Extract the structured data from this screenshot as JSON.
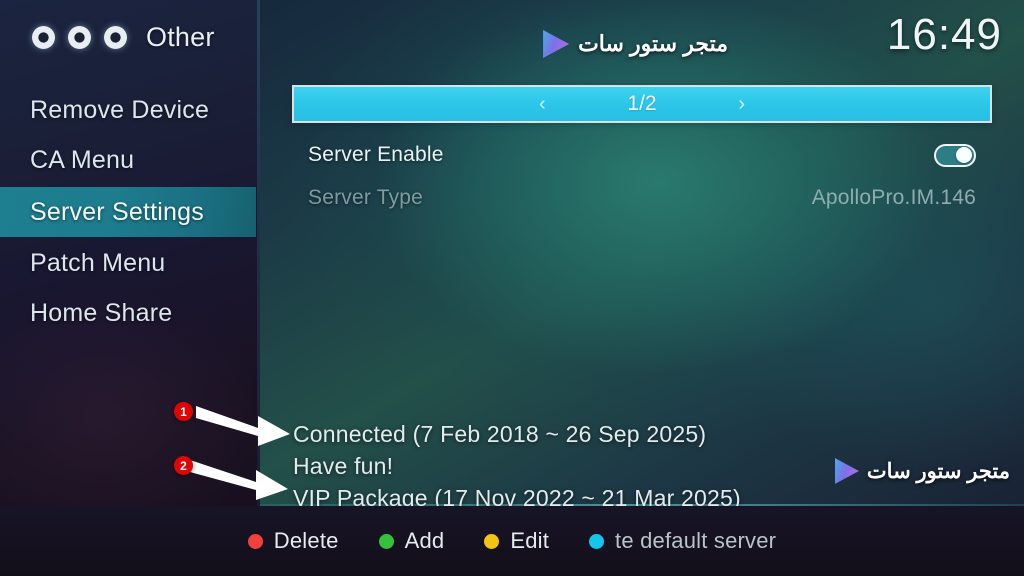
{
  "sidebar": {
    "brand": {
      "label": "Other",
      "dots_icon": "three-dots-icon"
    },
    "items": [
      {
        "label": "Remove Device",
        "active": false
      },
      {
        "label": "CA Menu",
        "active": false
      },
      {
        "label": "Server Settings",
        "active": true
      },
      {
        "label": "Patch Menu",
        "active": false
      },
      {
        "label": "Home Share",
        "active": false
      }
    ]
  },
  "header": {
    "brand_text": "متجر ستور سات",
    "play_icon": "play-triangle-icon",
    "clock": "16:49"
  },
  "pager": {
    "label": "1/2",
    "prev_icon": "‹",
    "next_icon": "›"
  },
  "settings": {
    "rows": [
      {
        "label": "Server Enable",
        "value": "",
        "control": "toggle",
        "toggle_on": true
      },
      {
        "label": "Server Type",
        "value": "ApolloPro.IM.146",
        "control": "text",
        "toggle_on": false
      }
    ]
  },
  "status": {
    "lines": [
      "Connected (7 Feb 2018 ~ 26 Sep 2025)",
      "Have fun!",
      "VIP Package (17 Nov 2022 ~ 21 Mar 2025)"
    ]
  },
  "watermark": {
    "text": "متجر ستور سات",
    "play_icon": "play-triangle-icon"
  },
  "annotations": [
    {
      "number": "1",
      "target": "Connected (7 Feb 2018 ~ 26 Sep 2025)"
    },
    {
      "number": "2",
      "target": "VIP Package (17 Nov 2022 ~ 21 Mar 2025)"
    }
  ],
  "bottom_bar": {
    "actions": [
      {
        "label": "Delete",
        "color": "#f0403f"
      },
      {
        "label": "Add",
        "color": "#35c03e"
      },
      {
        "label": "Edit",
        "color": "#f2c511"
      },
      {
        "label": "te default server",
        "color": "#15c6e8"
      }
    ]
  },
  "colors": {
    "accent_cyan": "#2cc6e8",
    "sidebar_active": "#1d7f90",
    "badge_red": "#e00505",
    "panel_teal": "#2a7c70"
  }
}
